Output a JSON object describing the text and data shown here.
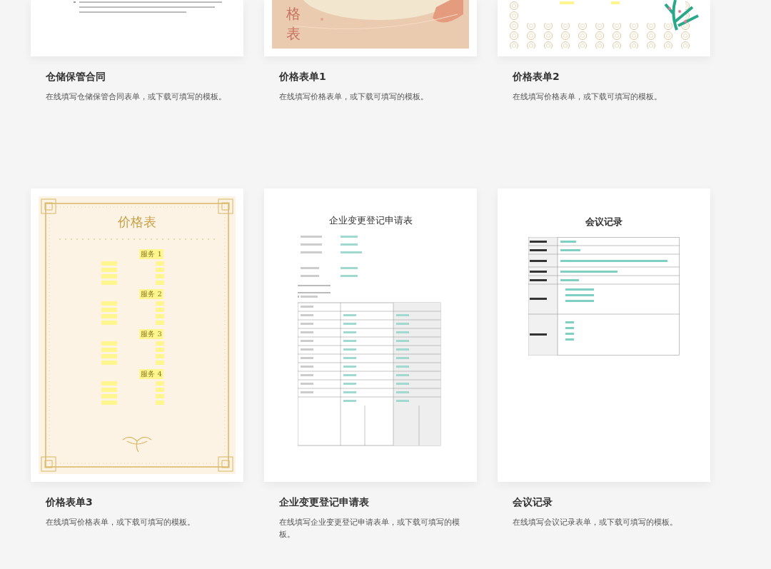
{
  "rows": [
    {
      "cards": [
        {
          "kind": "contract",
          "title": "仓储保管合同",
          "description": "在线填写仓储保管合同表单，或下载可填写的模板。"
        },
        {
          "kind": "price-peach",
          "title": "价格表单1",
          "description": "在线填写价格表单，或下载可填写的模板。",
          "preview_texts": [
            "格",
            "表"
          ]
        },
        {
          "kind": "price-pattern",
          "title": "价格表单2",
          "description": "在线填写价格表单，或下载可填写的模板。"
        }
      ]
    },
    {
      "cards": [
        {
          "kind": "price-gold",
          "title": "价格表单3",
          "description": "在线填写价格表单，或下载可填写的模板。",
          "preview_title": "价格表",
          "sections": [
            "服务 1",
            "服务 2",
            "服务 3",
            "服务 4"
          ]
        },
        {
          "kind": "form-table",
          "title": "企业变更登记申请表",
          "description": "在线填写企业变更登记申请表单，或下载可填写的模板。",
          "preview_title": "企业变更登记申请表"
        },
        {
          "kind": "meeting",
          "title": "会议记录",
          "description": "在线填写会议记录表单，或下载可填写的模板。",
          "preview_title": "会议记录"
        }
      ]
    }
  ]
}
